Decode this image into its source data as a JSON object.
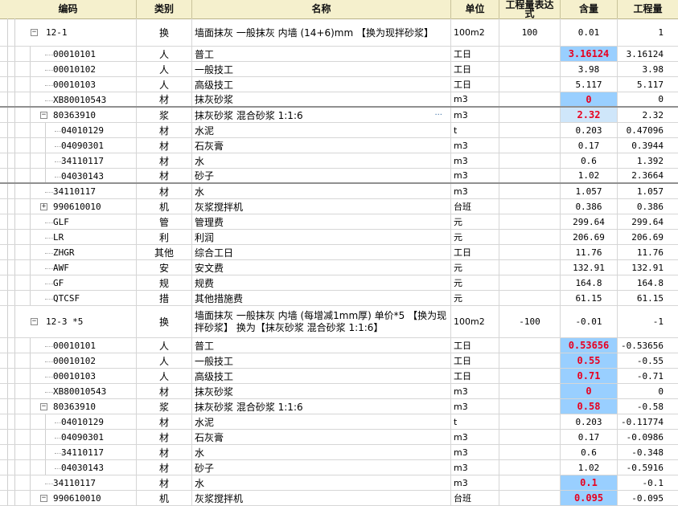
{
  "header": {
    "code": "编码",
    "type": "类别",
    "name": "名称",
    "unit": "单位",
    "expr": "工程量表达式",
    "qty": "含量",
    "amount": "工程量"
  },
  "rows": [
    {
      "level": 0,
      "toggle": "minus",
      "code": "12-1",
      "type": "换",
      "name": "墙面抹灰 一般抹灰 内墙 (14+6)mm 【换为现拌砂浆】",
      "unit": "100m2",
      "expr": "100",
      "qty": "0.01",
      "amount": "1",
      "h": "tall"
    },
    {
      "level": 1,
      "code": "00010101",
      "type": "人",
      "name": "普工",
      "unit": "工日",
      "qty": "3.16124",
      "amount": "3.16124",
      "hl": "hl"
    },
    {
      "level": 1,
      "code": "00010102",
      "type": "人",
      "name": "一般技工",
      "unit": "工日",
      "qty": "3.98",
      "amount": "3.98"
    },
    {
      "level": 1,
      "code": "00010103",
      "type": "人",
      "name": "高级技工",
      "unit": "工日",
      "qty": "5.117",
      "amount": "5.117"
    },
    {
      "level": 1,
      "code": "XB80010543",
      "type": "材",
      "name": "抹灰砂浆",
      "unit": "m3",
      "qty": "0",
      "amount": "0",
      "hl": "hl",
      "sep": true
    },
    {
      "level": 1,
      "toggle": "minus",
      "code": "80363910",
      "type": "浆",
      "name": "抹灰砂浆 混合砂浆 1:1:6",
      "unit": "m3",
      "qty": "2.32",
      "amount": "2.32",
      "hl": "hl-light",
      "ellipsis": "···"
    },
    {
      "level": 2,
      "code": "04010129",
      "type": "材",
      "name": "水泥",
      "unit": "t",
      "qty": "0.203",
      "amount": "0.47096"
    },
    {
      "level": 2,
      "code": "04090301",
      "type": "材",
      "name": "石灰膏",
      "unit": "m3",
      "qty": "0.17",
      "amount": "0.3944"
    },
    {
      "level": 2,
      "code": "34110117",
      "type": "材",
      "name": "水",
      "unit": "m3",
      "qty": "0.6",
      "amount": "1.392"
    },
    {
      "level": 2,
      "code": "04030143",
      "type": "材",
      "name": "砂子",
      "unit": "m3",
      "qty": "1.02",
      "amount": "2.3664",
      "sep": true
    },
    {
      "level": 1,
      "code": "34110117",
      "type": "材",
      "name": "水",
      "unit": "m3",
      "qty": "1.057",
      "amount": "1.057"
    },
    {
      "level": 1,
      "toggle": "plus",
      "code": "990610010",
      "type": "机",
      "name": "灰浆搅拌机",
      "unit": "台班",
      "qty": "0.386",
      "amount": "0.386"
    },
    {
      "level": 1,
      "code": "GLF",
      "type": "管",
      "name": "管理费",
      "unit": "元",
      "qty": "299.64",
      "amount": "299.64"
    },
    {
      "level": 1,
      "code": "LR",
      "type": "利",
      "name": "利润",
      "unit": "元",
      "qty": "206.69",
      "amount": "206.69"
    },
    {
      "level": 1,
      "code": "ZHGR",
      "type": "其他",
      "name": "综合工日",
      "unit": "工日",
      "qty": "11.76",
      "amount": "11.76"
    },
    {
      "level": 1,
      "code": "AWF",
      "type": "安",
      "name": "安文费",
      "unit": "元",
      "qty": "132.91",
      "amount": "132.91"
    },
    {
      "level": 1,
      "code": "GF",
      "type": "规",
      "name": "规费",
      "unit": "元",
      "qty": "164.8",
      "amount": "164.8"
    },
    {
      "level": 1,
      "code": "QTCSF",
      "type": "措",
      "name": "其他措施费",
      "unit": "元",
      "qty": "61.15",
      "amount": "61.15"
    },
    {
      "level": 0,
      "toggle": "minus",
      "code": "12-3 *5",
      "type": "换",
      "name": "墙面抹灰 一般抹灰 内墙 (每增减1mm厚) 单价*5 【换为现拌砂浆】 换为【抹灰砂浆 混合砂浆 1:1:6】",
      "unit": "100m2",
      "expr": "-100",
      "qty": "-0.01",
      "amount": "-1",
      "h": "xtall",
      "wrap": true
    },
    {
      "level": 1,
      "code": "00010101",
      "type": "人",
      "name": "普工",
      "unit": "工日",
      "qty": "0.53656",
      "amount": "-0.53656",
      "hl": "hl"
    },
    {
      "level": 1,
      "code": "00010102",
      "type": "人",
      "name": "一般技工",
      "unit": "工日",
      "qty": "0.55",
      "amount": "-0.55",
      "hl": "hl"
    },
    {
      "level": 1,
      "code": "00010103",
      "type": "人",
      "name": "高级技工",
      "unit": "工日",
      "qty": "0.71",
      "amount": "-0.71",
      "hl": "hl"
    },
    {
      "level": 1,
      "code": "XB80010543",
      "type": "材",
      "name": "抹灰砂浆",
      "unit": "m3",
      "qty": "0",
      "amount": "0",
      "hl": "hl"
    },
    {
      "level": 1,
      "toggle": "minus",
      "code": "80363910",
      "type": "浆",
      "name": "抹灰砂浆 混合砂浆 1:1:6",
      "unit": "m3",
      "qty": "0.58",
      "amount": "-0.58",
      "hl": "hl"
    },
    {
      "level": 2,
      "code": "04010129",
      "type": "材",
      "name": "水泥",
      "unit": "t",
      "qty": "0.203",
      "amount": "-0.11774"
    },
    {
      "level": 2,
      "code": "04090301",
      "type": "材",
      "name": "石灰膏",
      "unit": "m3",
      "qty": "0.17",
      "amount": "-0.0986"
    },
    {
      "level": 2,
      "code": "34110117",
      "type": "材",
      "name": "水",
      "unit": "m3",
      "qty": "0.6",
      "amount": "-0.348"
    },
    {
      "level": 2,
      "code": "04030143",
      "type": "材",
      "name": "砂子",
      "unit": "m3",
      "qty": "1.02",
      "amount": "-0.5916"
    },
    {
      "level": 1,
      "code": "34110117",
      "type": "材",
      "name": "水",
      "unit": "m3",
      "qty": "0.1",
      "amount": "-0.1",
      "hl": "hl"
    },
    {
      "level": 1,
      "toggle": "minus",
      "code": "990610010",
      "type": "机",
      "name": "灰浆搅拌机",
      "unit": "台班",
      "qty": "0.095",
      "amount": "-0.095",
      "hl": "hl"
    }
  ]
}
